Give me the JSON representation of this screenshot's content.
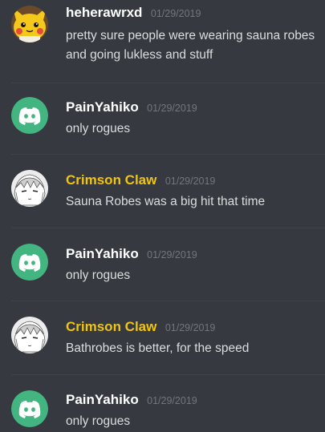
{
  "messages": [
    {
      "author": "heherawrxd",
      "timestamp": "01/29/2019",
      "text": "pretty sure people were wearing sauna robes and going lukless and stuff",
      "avatar": "pikachu-avatar",
      "author_color": "#ffffff"
    },
    {
      "author": "PainYahiko",
      "timestamp": "01/29/2019",
      "text": "only  rogues",
      "avatar": "discord-default-avatar",
      "author_color": "#ffffff"
    },
    {
      "author": "Crimson Claw",
      "timestamp": "01/29/2019",
      "text": "Sauna Robes was a big hit that time",
      "avatar": "anime-sketch-avatar",
      "author_color": "#f1c40f"
    },
    {
      "author": "PainYahiko",
      "timestamp": "01/29/2019",
      "text": "only rogues",
      "avatar": "discord-default-avatar",
      "author_color": "#ffffff"
    },
    {
      "author": "Crimson Claw",
      "timestamp": "01/29/2019",
      "text": "Bathrobes is better, for the speed",
      "avatar": "anime-sketch-avatar",
      "author_color": "#f1c40f"
    },
    {
      "author": "PainYahiko",
      "timestamp": "01/29/2019",
      "text": "only rogues",
      "avatar": "discord-default-avatar",
      "author_color": "#ffffff"
    }
  ],
  "colors": {
    "background": "#36393f",
    "divider": "#3f4248",
    "timestamp": "#72767d",
    "text": "#dcddde",
    "discord_green": "#43b581"
  }
}
